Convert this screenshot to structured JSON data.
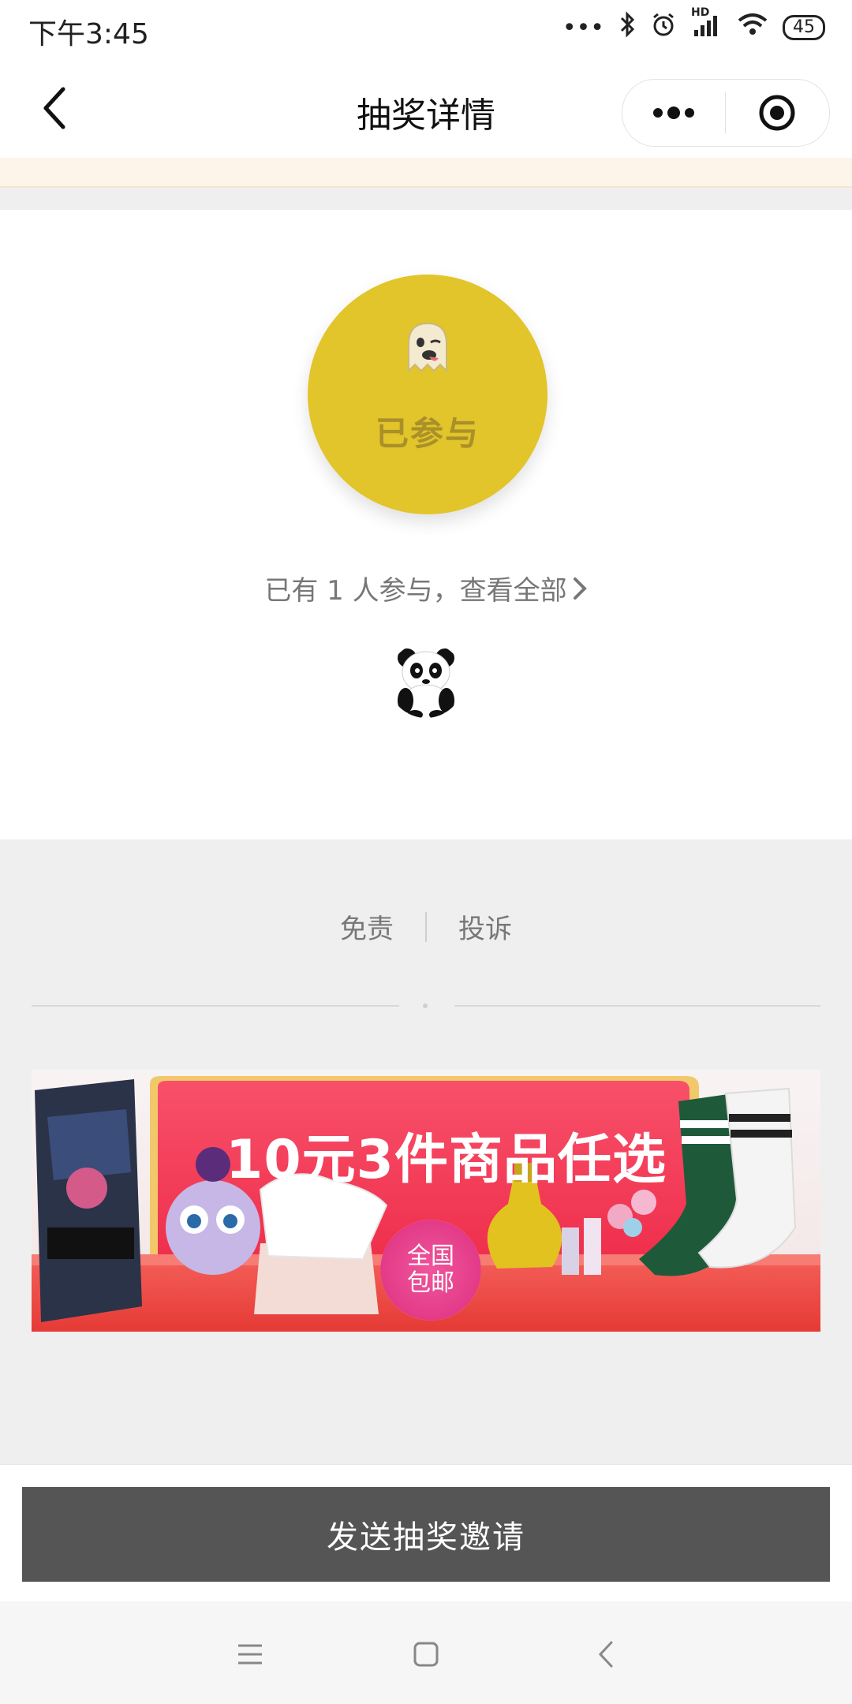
{
  "status_bar": {
    "time": "下午3:45",
    "network": "HD",
    "battery": "45"
  },
  "nav": {
    "title": "抽奖详情"
  },
  "join": {
    "label": "已参与",
    "participants_text": "已有 1 人参与，查看全部"
  },
  "footer": {
    "disclaimer": "免责",
    "complaint": "投诉"
  },
  "banner": {
    "headline": "10元3件商品任选",
    "badge": "全国包邮"
  },
  "action": {
    "send_invite": "发送抽奖邀请"
  },
  "colors": {
    "join_circle": "#e2c42b",
    "cta_button": "#555555",
    "notice_bar": "#fdf5e9"
  },
  "icons": {
    "back": "chevron-left-icon",
    "more": "more-dots-icon",
    "close": "target-circle-icon",
    "ghost": "ghost-emoji-icon",
    "chevron": "chevron-right-icon"
  }
}
